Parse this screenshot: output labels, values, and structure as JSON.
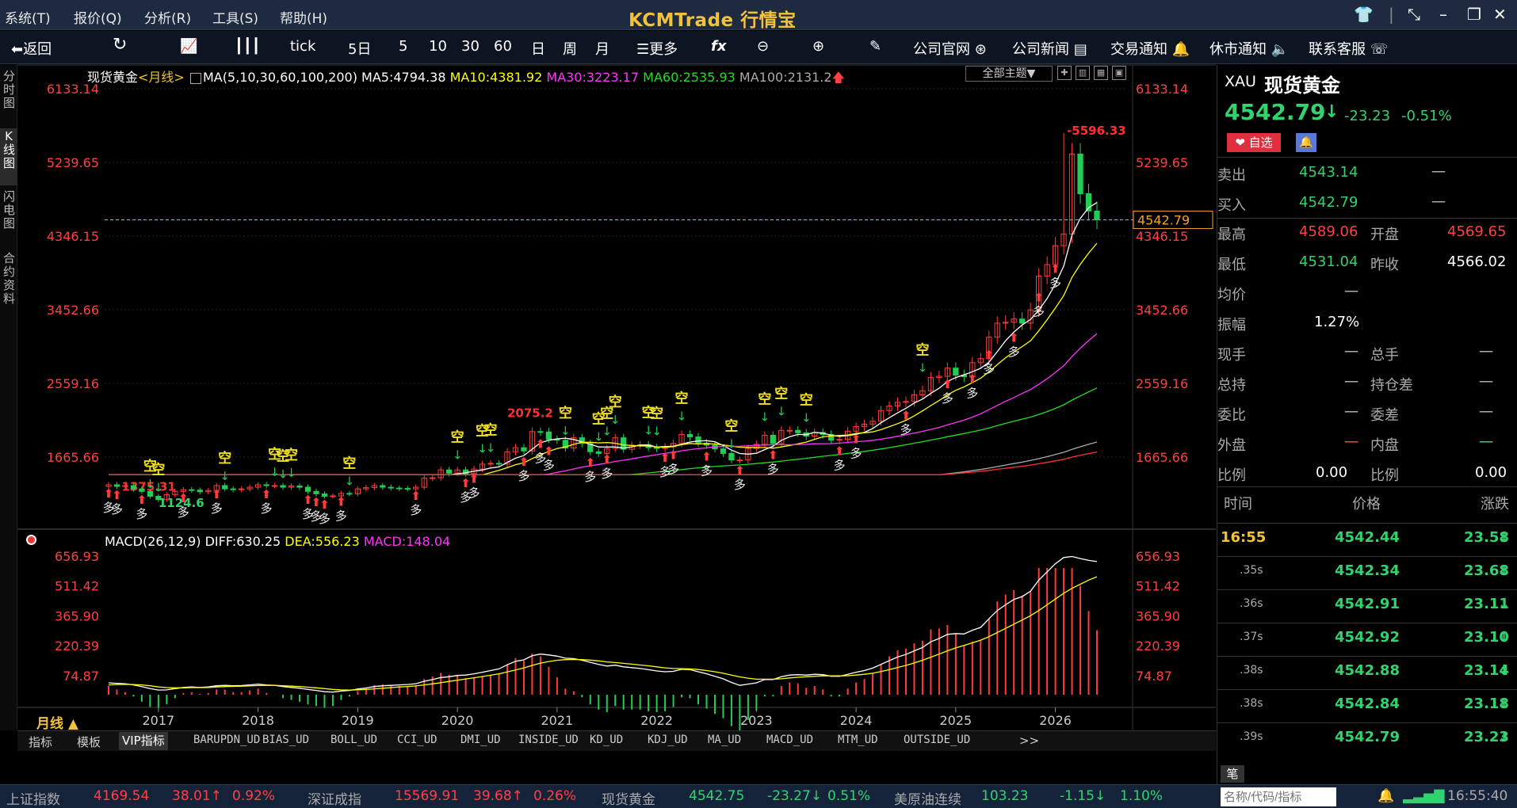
{
  "menu": {
    "items": [
      "系统(T)",
      "报价(Q)",
      "分析(R)",
      "工具(S)",
      "帮助(H)"
    ],
    "logo": "KCMTrade 行情宝"
  },
  "toolbar": {
    "back": "返回",
    "items": [
      "tick",
      "5日",
      "5",
      "10",
      "30",
      "60",
      "日",
      "周",
      "月",
      "更多"
    ],
    "links": [
      "公司官网",
      "公司新闻",
      "交易通知",
      "休市通知",
      "联系客服"
    ]
  },
  "left_tabs": [
    "分时图",
    "K线图",
    "闪电图",
    "合约资料"
  ],
  "chart": {
    "symbol": "现货黄金",
    "period": "<月线>",
    "ma_legend": {
      "label": "MA(5,10,30,60,100,200)",
      "ma5": "MA5:4794.38",
      "ma10": "MA10:4381.92",
      "ma30": "MA30:3223.17",
      "ma60": "MA60:2535.93",
      "ma100": "MA100:2131.2"
    },
    "theme_btn": "全部主题▼",
    "price_ticks": [
      "6133.14",
      "5239.65",
      "4346.15",
      "3452.66",
      "2559.16",
      "1665.66"
    ],
    "current_price_tag": "4542.79",
    "high_label": "5596.33",
    "mid_label": "2075.2",
    "low_label": "1124.6",
    "early_label": "1375.31",
    "macd_legend": {
      "label": "MACD(26,12,9)",
      "diff": "DIFF:630.25",
      "dea": "DEA:556.23",
      "macd": "MACD:148.04"
    },
    "macd_ticks": [
      "656.93",
      "511.42",
      "365.90",
      "220.39",
      "74.87"
    ],
    "years": [
      "2017",
      "2018",
      "2019",
      "2020",
      "2021",
      "2022",
      "2023",
      "2024",
      "2025",
      "2026"
    ],
    "period_btn": "月线 ▲",
    "signal_long": "多",
    "signal_short": "空",
    "colors": {
      "up": "#ff3b3b",
      "down": "#22cc55",
      "ma5": "#ffffff",
      "ma10": "#ffff00",
      "ma30": "#ff33ff",
      "ma60": "#22dd22",
      "ma100": "#aaaaaa",
      "ma200": "#ff3333",
      "price_axis": "#ff4040"
    }
  },
  "chart_data": {
    "type": "candlestick",
    "title": "现货黄金",
    "ylim": [
      1240,
      6133.14
    ],
    "x_range": [
      "2016-07",
      "2026-03"
    ],
    "close_monthly": [
      1330,
      1310,
      1320,
      1280,
      1250,
      1190,
      1150,
      1210,
      1250,
      1270,
      1265,
      1245,
      1260,
      1320,
      1280,
      1270,
      1280,
      1300,
      1330,
      1320,
      1320,
      1300,
      1315,
      1300,
      1250,
      1220,
      1190,
      1195,
      1225,
      1220,
      1280,
      1295,
      1320,
      1300,
      1290,
      1285,
      1280,
      1300,
      1410,
      1415,
      1510,
      1470,
      1510,
      1465,
      1520,
      1580,
      1590,
      1580,
      1730,
      1780,
      1740,
      1975,
      1970,
      1880,
      1870,
      1775,
      1900,
      1830,
      1730,
      1710,
      1770,
      1900,
      1760,
      1810,
      1815,
      1780,
      1770,
      1790,
      1830,
      1940,
      1910,
      1835,
      1810,
      1765,
      1710,
      1630,
      1630,
      1770,
      1820,
      1930,
      1830,
      1990,
      1990,
      1960,
      1920,
      1965,
      1940,
      1870,
      1880,
      1980,
      2035,
      2065,
      2100,
      2230,
      2285,
      2330,
      2340,
      2420,
      2470,
      2630,
      2645,
      2745,
      2660,
      2640,
      2810,
      2860,
      3120,
      3290,
      3300,
      3340,
      3290,
      3450,
      3860,
      4000,
      4230,
      4370,
      5340,
      4860,
      4650,
      4542.79
    ],
    "high_label": 5596.33,
    "last": 4542.79,
    "open": 4569.65,
    "high": 4589.06,
    "low": 4531.04,
    "prev_close": 4566.02
  },
  "macd_data": {
    "type": "line",
    "ylim": [
      0,
      700
    ],
    "diff": [
      40,
      38,
      36,
      30,
      22,
      12,
      5,
      6,
      12,
      18,
      20,
      18,
      20,
      26,
      28,
      26,
      27,
      30,
      34,
      30,
      28,
      22,
      18,
      14,
      8,
      3,
      -3,
      -5,
      0,
      3,
      10,
      15,
      22,
      26,
      28,
      30,
      32,
      36,
      48,
      56,
      66,
      70,
      76,
      78,
      84,
      92,
      100,
      108,
      128,
      145,
      152,
      172,
      180,
      176,
      170,
      160,
      158,
      150,
      140,
      130,
      122,
      126,
      118,
      114,
      110,
      104,
      98,
      94,
      96,
      106,
      104,
      94,
      84,
      72,
      60,
      42,
      28,
      34,
      40,
      56,
      56,
      70,
      78,
      80,
      78,
      82,
      80,
      72,
      72,
      82,
      92,
      100,
      112,
      130,
      148,
      166,
      178,
      196,
      212,
      240,
      256,
      276,
      280,
      278,
      296,
      310,
      352,
      392,
      420,
      446,
      460,
      486,
      540,
      580,
      620,
      650,
      655,
      645,
      636,
      630.25
    ],
    "dea": [
      30,
      32,
      33,
      32,
      30,
      26,
      20,
      17,
      16,
      16,
      17,
      17,
      18,
      20,
      22,
      23,
      24,
      25,
      27,
      28,
      28,
      26,
      24,
      22,
      19,
      16,
      12,
      8,
      6,
      5,
      6,
      8,
      11,
      14,
      17,
      20,
      22,
      25,
      30,
      35,
      41,
      47,
      53,
      59,
      65,
      71,
      77,
      84,
      93,
      103,
      113,
      125,
      136,
      144,
      150,
      153,
      154,
      153,
      151,
      147,
      142,
      139,
      135,
      131,
      127,
      123,
      118,
      113,
      110,
      109,
      108,
      105,
      100,
      94,
      87,
      78,
      69,
      63,
      58,
      58,
      58,
      60,
      64,
      67,
      70,
      72,
      74,
      74,
      74,
      75,
      78,
      82,
      87,
      95,
      104,
      115,
      125,
      137,
      150,
      165,
      180,
      196,
      210,
      222,
      235,
      248,
      265,
      285,
      305,
      326,
      346,
      367,
      392,
      420,
      448,
      476,
      500,
      520,
      540,
      556.23
    ],
    "macd_ticks": [
      656.93,
      511.42,
      365.9,
      220.39,
      74.87
    ]
  },
  "quote": {
    "code": "XAU",
    "name": "现货黄金",
    "price": "4542.79",
    "arrow": "↓",
    "change": "-23.23",
    "pct": "-0.51%",
    "fav": "自选",
    "sell_label": "卖出",
    "sell": "4543.14",
    "buy_label": "买入",
    "buy": "4542.79",
    "dash": "一",
    "high_label": "最高",
    "high": "4589.06",
    "open_label": "开盘",
    "open": "4569.65",
    "low_label": "最低",
    "low": "4531.04",
    "prev_label": "昨收",
    "prev": "4566.02",
    "avg_label": "均价",
    "avg": "一",
    "amp_label": "振幅",
    "amp": "1.27%",
    "rows": [
      [
        "现手",
        "一",
        "总手",
        "一"
      ],
      [
        "总持",
        "一",
        "持仓差",
        "一"
      ],
      [
        "委比",
        "一",
        "委差",
        "一"
      ],
      [
        "外盘",
        "一",
        "内盘",
        "一"
      ],
      [
        "比例",
        "0.00",
        "比例",
        "0.00"
      ]
    ]
  },
  "ticks": {
    "head": [
      "时间",
      "价格",
      "涨跌"
    ],
    "rows": [
      [
        "16:55",
        "4542.44",
        "23.58"
      ],
      [
        ".35s",
        "4542.34",
        "23.68"
      ],
      [
        ".36s",
        "4542.91",
        "23.11"
      ],
      [
        ".37s",
        "4542.92",
        "23.10"
      ],
      [
        ".38s",
        "4542.88",
        "23.14"
      ],
      [
        ".38s",
        "4542.84",
        "23.18"
      ],
      [
        ".39s",
        "4542.79",
        "23.23"
      ]
    ],
    "footer": "笔"
  },
  "indicator_tabs": [
    "指标",
    "模板",
    "VIP指标",
    "BARUPDN_UD",
    "BIAS_UD",
    "BOLL_UD",
    "CCI_UD",
    "DMI_UD",
    "INSIDE_UD",
    "KD_UD",
    "KDJ_UD",
    "MA_UD",
    "MACD_UD",
    "MTM_UD",
    "OUTSIDE_UD",
    ">>"
  ],
  "statusbar": {
    "items": [
      {
        "name": "上证指数",
        "v": "4169.54",
        "c": "38.01↑",
        "p": "0.92%",
        "cls": "red"
      },
      {
        "name": "深证成指",
        "v": "15569.91",
        "c": "39.68↑",
        "p": "0.26%",
        "cls": "red"
      },
      {
        "name": "现货黄金",
        "v": "4542.75",
        "c": "-23.27↓",
        "p": "0.51%",
        "cls": "grn"
      },
      {
        "name": "美原油连续",
        "v": "103.23",
        "c": "-1.15↓",
        "p": "1.10%",
        "cls": "grn"
      }
    ],
    "search_placeholder": "名称/代码/指标",
    "clock": "16:55:40"
  }
}
